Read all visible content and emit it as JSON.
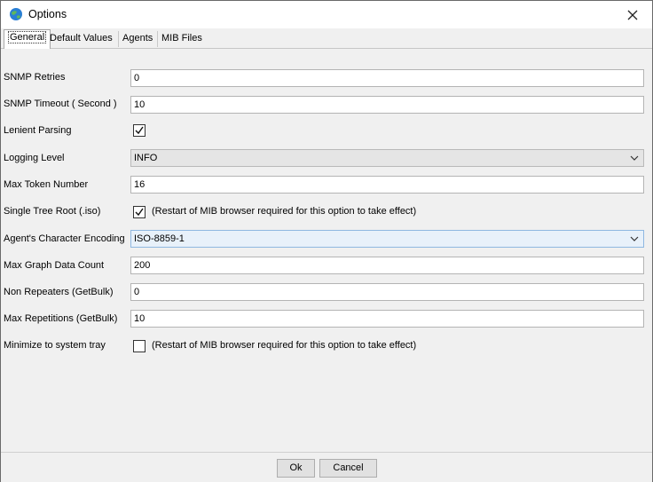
{
  "window": {
    "title": "Options"
  },
  "tabs": [
    {
      "label": "General",
      "active": true
    },
    {
      "label": "Default Values",
      "active": false
    },
    {
      "label": "Agents",
      "active": false
    },
    {
      "label": "MIB Files",
      "active": false
    }
  ],
  "form": {
    "snmp_retries": {
      "label": "SNMP Retries",
      "value": "0"
    },
    "snmp_timeout": {
      "label": "SNMP Timeout ( Second )",
      "value": "10"
    },
    "lenient_parsing": {
      "label": "Lenient Parsing",
      "checked": true
    },
    "logging_level": {
      "label": "Logging Level",
      "value": "INFO"
    },
    "max_token_number": {
      "label": "Max Token Number",
      "value": "16"
    },
    "single_tree_root": {
      "label": "Single Tree Root (.iso)",
      "checked": true,
      "note": "(Restart of MIB browser required for this option to take effect)"
    },
    "agent_encoding": {
      "label": "Agent's Character Encoding",
      "value": "ISO-8859-1"
    },
    "max_graph_data_count": {
      "label": "Max Graph Data Count",
      "value": "200"
    },
    "non_repeaters": {
      "label": "Non Repeaters (GetBulk)",
      "value": "0"
    },
    "max_repetitions": {
      "label": "Max Repetitions (GetBulk)",
      "value": "10"
    },
    "minimize_tray": {
      "label": "Minimize to system tray",
      "checked": false,
      "note": "(Restart of MIB browser required for this option to take effect)"
    }
  },
  "buttons": {
    "ok": "Ok",
    "cancel": "Cancel"
  },
  "icons": {
    "app": "globe-icon",
    "close": "close-icon",
    "dropdown": "chevron-down-icon",
    "check": "checkmark-icon"
  },
  "colors": {
    "focus_border": "#8fb8e1",
    "focus_fill": "#e8f1fa"
  }
}
